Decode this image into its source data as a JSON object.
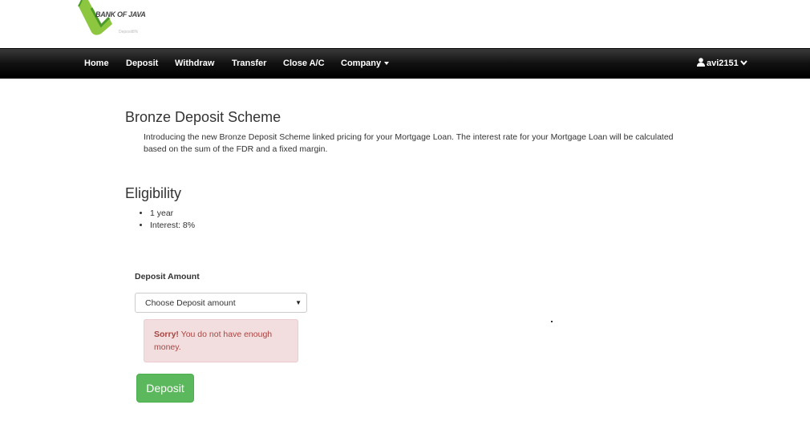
{
  "logo": {
    "text": "BANK OF JAVA",
    "sub": "Deposit8%",
    "colors": {
      "green": "#8dc63f",
      "dark_green": "#4c9a2a"
    }
  },
  "navbar": {
    "items": [
      {
        "label": "Home"
      },
      {
        "label": "Deposit"
      },
      {
        "label": "Withdraw"
      },
      {
        "label": "Transfer"
      },
      {
        "label": "Close A/C"
      },
      {
        "label": "Company",
        "dropdown": true
      }
    ],
    "user": {
      "name": "avi2151",
      "icon": "user-icon",
      "chevron": "chevron-down-icon"
    }
  },
  "scheme": {
    "title": "Bronze Deposit Scheme",
    "intro": "Introducing the new Bronze Deposit Scheme linked pricing for your Mortgage Loan. The interest rate for your Mortgage Loan will be calculated based on the sum of the FDR and a fixed margin."
  },
  "eligibility": {
    "title": "Eligibility",
    "items": [
      "1 year",
      "Interest: 8%"
    ]
  },
  "form": {
    "label": "Deposit Amount",
    "select_value": "Choose Deposit amount",
    "alert_strong": "Sorry!",
    "alert_text": " You do not have enough money.",
    "button": "Deposit",
    "colors": {
      "alert_bg": "#f2dede",
      "alert_text": "#a94442",
      "button": "#5cb85c"
    }
  }
}
